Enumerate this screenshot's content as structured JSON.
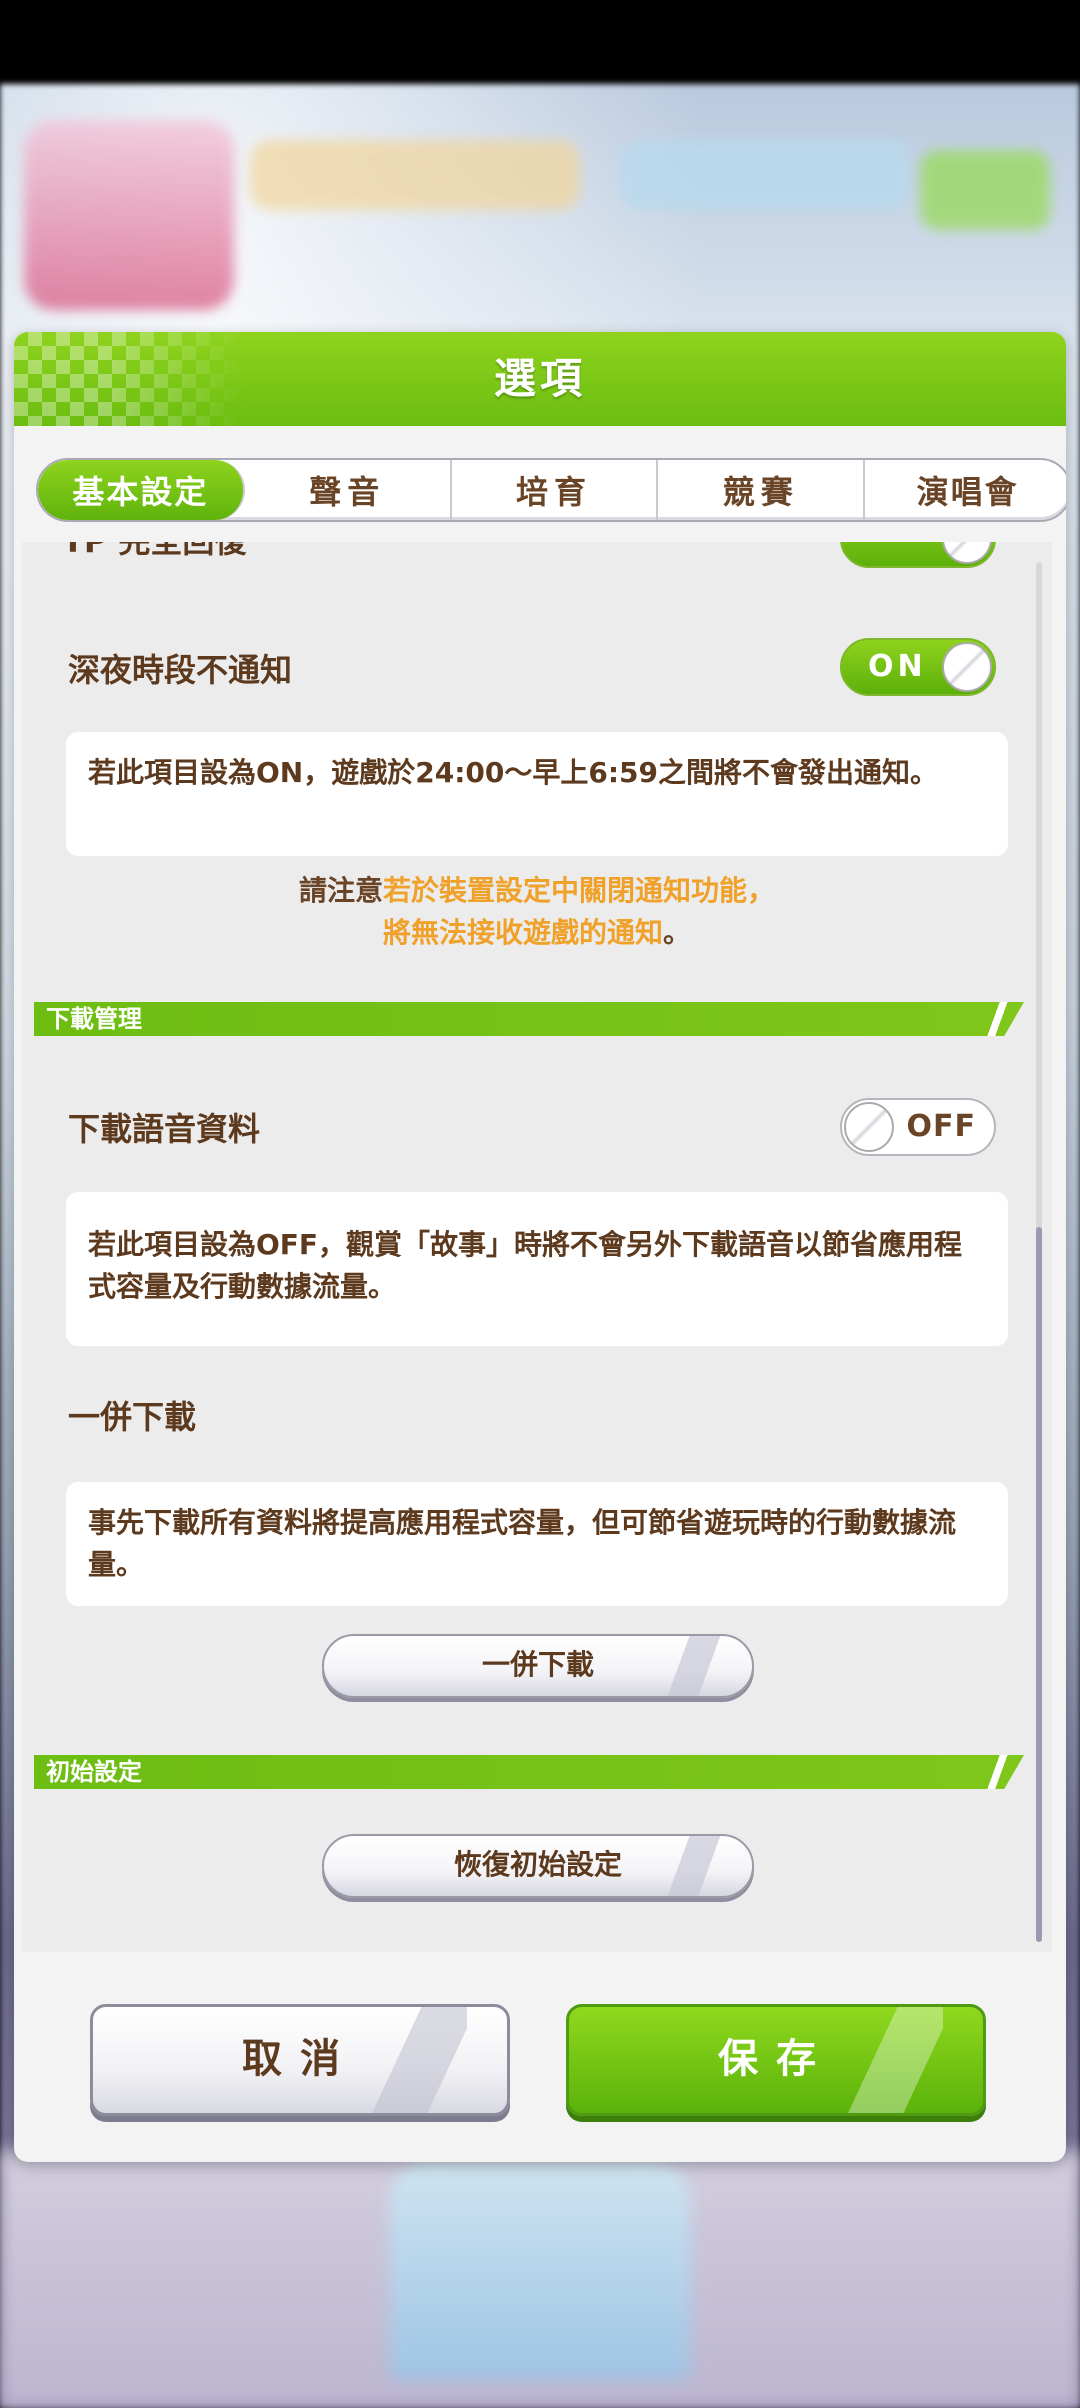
{
  "dialog": {
    "title": "選項"
  },
  "tabs": [
    "基本設定",
    "聲音",
    "培育",
    "競賽",
    "演唱會"
  ],
  "settings": {
    "cutoff_label": "TP 完全回復",
    "night_notify": {
      "label": "深夜時段不通知",
      "state": "ON",
      "description": "若此項目設為ON，遊戲於24:00～早上6:59之間將不會發出通知。",
      "note_prefix": "請注意",
      "note_highlight": "若於裝置設定中關閉通知功能，",
      "note_line2_highlight": "將無法接收遊戲的通知",
      "note_line2_suffix": "。"
    }
  },
  "download_section": {
    "title": "下載管理",
    "voice": {
      "label": "下載語音資料",
      "state": "OFF",
      "description": "若此項目設為OFF，觀賞「故事」時將不會另外下載語音以節省應用程式容量及行動數據流量。"
    },
    "bulk": {
      "label": "一併下載",
      "description": "事先下載所有資料將提高應用程式容量，但可節省遊玩時的行動數據流量。",
      "button": "一併下載"
    }
  },
  "reset_section": {
    "title": "初始設定",
    "button": "恢復初始設定"
  },
  "footer": {
    "cancel": "取消",
    "save": "保存"
  },
  "colors": {
    "accent_green": "#6bbd10",
    "text_brown": "#5d3a1e",
    "note_orange": "#f0a12a"
  }
}
